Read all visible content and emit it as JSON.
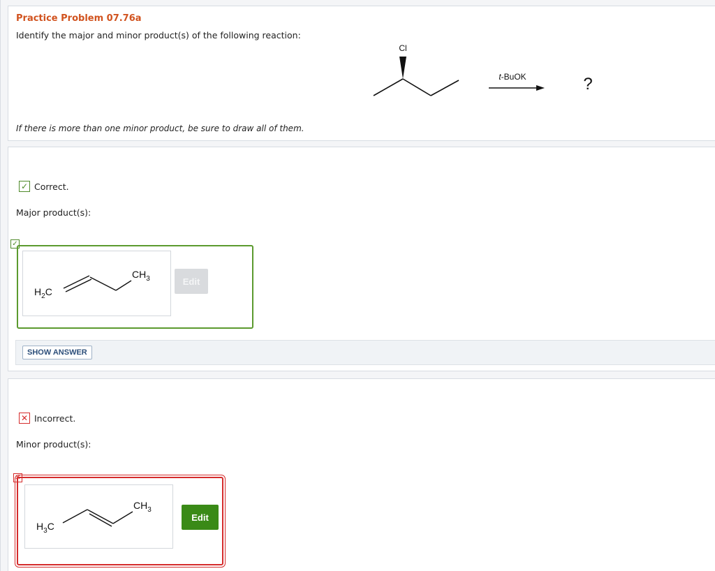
{
  "question": {
    "title": "Practice Problem 07.76a",
    "prompt": "Identify the major and minor product(s) of the following reaction:",
    "note": "If there is more than one minor product, be sure to draw all of them.",
    "reaction": {
      "substituent": "Cl",
      "reagent": "t-BuOK",
      "product": "?"
    }
  },
  "major": {
    "status": "Correct.",
    "status_icon": "check-icon",
    "label": "Major product(s):",
    "structure": {
      "left_group_main": "H",
      "left_group_sub": "2",
      "left_group_tail": "C",
      "right_group_main": "CH",
      "right_group_sub": "3"
    },
    "edit_label": "Edit",
    "show_answer_label": "SHOW ANSWER",
    "color": "#5b9a2e"
  },
  "minor": {
    "status": "Incorrect.",
    "status_icon": "x-icon",
    "label": "Minor product(s):",
    "structure": {
      "left_group_main": "H",
      "left_group_sub": "3",
      "left_group_tail": "C",
      "right_group_main": "CH",
      "right_group_sub": "3"
    },
    "edit_label": "Edit",
    "color": "#d52b2b"
  },
  "colors": {
    "title": "#d1531f",
    "edit_active": "#3a8a17",
    "edit_disabled": "#d9dbde"
  }
}
